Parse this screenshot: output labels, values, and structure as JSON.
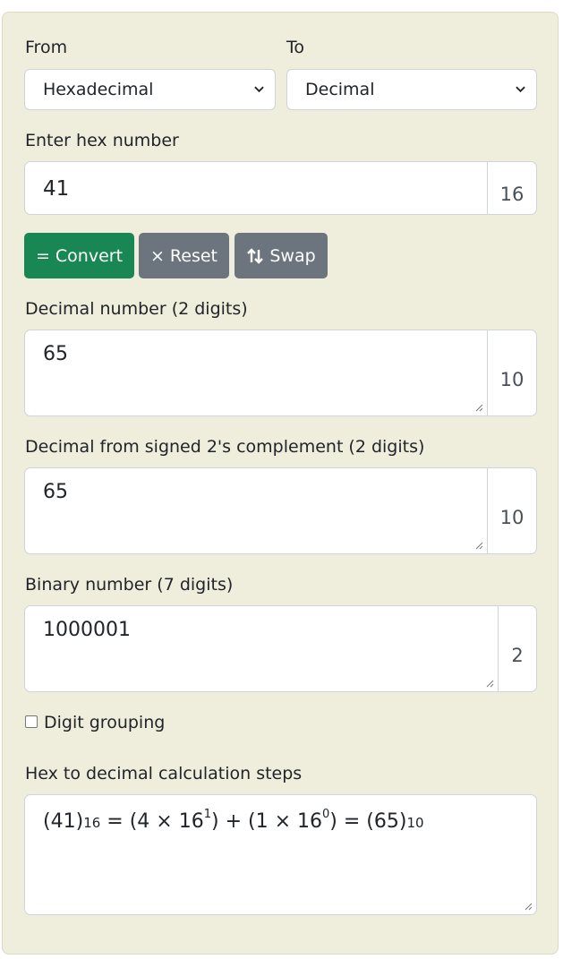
{
  "from": {
    "label": "From",
    "selected": "Hexadecimal"
  },
  "to": {
    "label": "To",
    "selected": "Decimal"
  },
  "input": {
    "label": "Enter hex number",
    "value": "41",
    "base": "16"
  },
  "buttons": {
    "convert": "= Convert",
    "reset": "× Reset",
    "swap": "Swap"
  },
  "decimal": {
    "label": "Decimal number (2 digits)",
    "value": "65",
    "base": "10"
  },
  "signed": {
    "label": "Decimal from signed 2's complement (2 digits)",
    "value": "65",
    "base": "10"
  },
  "binary": {
    "label": "Binary number (7 digits)",
    "value": "1000001",
    "base": "2"
  },
  "grouping": {
    "label": "Digit grouping",
    "checked": false
  },
  "steps": {
    "label": "Hex to decimal calculation steps",
    "hex_value": "41",
    "hex_base": "16",
    "digit1": "4",
    "exp1": "1",
    "digit2": "1",
    "exp2": "0",
    "result": "65",
    "result_base": "10",
    "power_base": "16"
  },
  "colors": {
    "panel": "#efeddb",
    "convert": "#198754",
    "secondary": "#6c757d"
  }
}
